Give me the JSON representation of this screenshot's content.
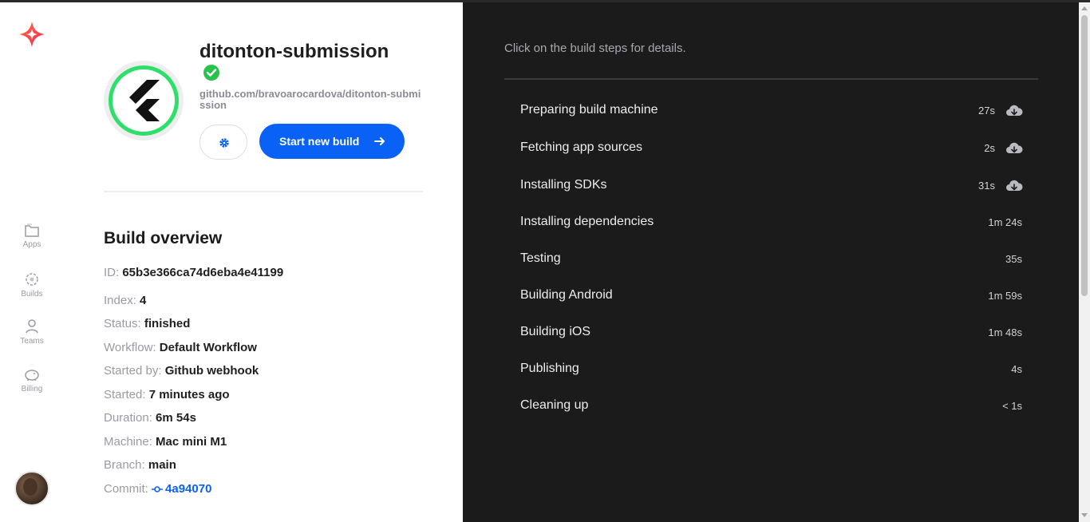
{
  "nav": {
    "items": [
      {
        "label": "Apps",
        "icon": "folder-icon"
      },
      {
        "label": "Builds",
        "icon": "builds-icon"
      },
      {
        "label": "Teams",
        "icon": "user-icon"
      },
      {
        "label": "Billing",
        "icon": "piggy-bank-icon"
      }
    ]
  },
  "app": {
    "name": "ditonton-submission",
    "repo": "github.com/bravoarocardova/ditonton-submission",
    "start_build_label": "Start new build"
  },
  "overview": {
    "title": "Build overview",
    "fields": [
      {
        "key": "ID:",
        "value": "65b3e366ca74d6eba4e41199"
      },
      {
        "key": "Index:",
        "value": "4"
      },
      {
        "key": "Status:",
        "value": "finished"
      },
      {
        "key": "Workflow:",
        "value": "Default Workflow"
      },
      {
        "key": "Started by:",
        "value": "Github webhook"
      },
      {
        "key": "Started:",
        "value": "7 minutes ago"
      },
      {
        "key": "Duration:",
        "value": "6m 54s"
      },
      {
        "key": "Machine:",
        "value": "Mac mini M1"
      },
      {
        "key": "Branch:",
        "value": "main"
      },
      {
        "key": "Commit:",
        "value": "4a94070"
      }
    ]
  },
  "steps_panel": {
    "hint": "Click on the build steps for details.",
    "steps": [
      {
        "name": "Preparing build machine",
        "duration": "27s",
        "download": true
      },
      {
        "name": "Fetching app sources",
        "duration": "2s",
        "download": true
      },
      {
        "name": "Installing SDKs",
        "duration": "31s",
        "download": true
      },
      {
        "name": "Installing dependencies",
        "duration": "1m 24s",
        "download": false
      },
      {
        "name": "Testing",
        "duration": "35s",
        "download": false
      },
      {
        "name": "Building Android",
        "duration": "1m 59s",
        "download": false
      },
      {
        "name": "Building iOS",
        "duration": "1m 48s",
        "download": false
      },
      {
        "name": "Publishing",
        "duration": "4s",
        "download": false
      },
      {
        "name": "Cleaning up",
        "duration": "< 1s",
        "download": false
      }
    ]
  },
  "colors": {
    "accent": "#0a61f5",
    "success": "#2ee06b",
    "dark_panel": "#1b1b1b"
  }
}
